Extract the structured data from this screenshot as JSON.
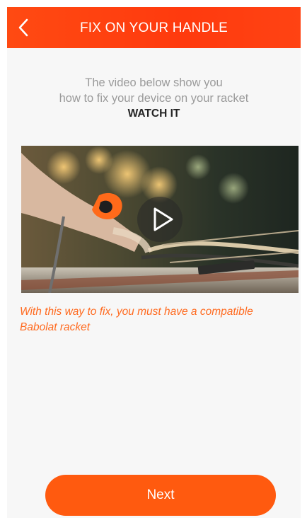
{
  "header": {
    "title": "FIX ON YOUR HANDLE",
    "back_icon": "chevron-left-icon"
  },
  "intro": {
    "line1": "The video below show you",
    "line2": "how to fix your device on your racket",
    "cta": "WATCH IT"
  },
  "video": {
    "play_icon": "play-icon"
  },
  "note": {
    "text": "With this way to fix, you must have a compatible Babolat racket"
  },
  "footer": {
    "next_label": "Next"
  },
  "colors": {
    "accent": "#ff4a12",
    "note": "#ff6a1f",
    "button": "#ff5a0f"
  }
}
